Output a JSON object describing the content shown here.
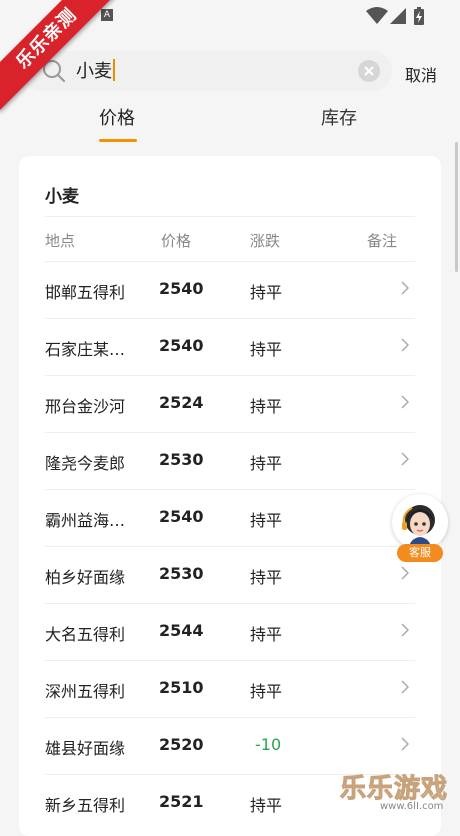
{
  "status_bar": {
    "a_icon": "A",
    "icons": [
      "wifi-icon",
      "cell-signal-icon",
      "battery-charging-icon"
    ]
  },
  "ribbon": {
    "text": "乐乐亲测"
  },
  "search": {
    "query": "小麦",
    "cancel_label": "取消"
  },
  "tabs": [
    {
      "label": "价格",
      "active": true
    },
    {
      "label": "库存",
      "active": false
    }
  ],
  "card": {
    "title": "小麦",
    "columns": [
      "地点",
      "价格",
      "涨跌",
      "备注"
    ],
    "rows": [
      {
        "location": "邯郸五得利",
        "price": "2540",
        "change": "持平"
      },
      {
        "location": "石家庄某…",
        "price": "2540",
        "change": "持平"
      },
      {
        "location": "邢台金沙河",
        "price": "2524",
        "change": "持平"
      },
      {
        "location": "隆尧今麦郎",
        "price": "2530",
        "change": "持平"
      },
      {
        "location": "霸州益海…",
        "price": "2540",
        "change": "持平"
      },
      {
        "location": "柏乡好面缘",
        "price": "2530",
        "change": "持平"
      },
      {
        "location": "大名五得利",
        "price": "2544",
        "change": "持平"
      },
      {
        "location": "深州五得利",
        "price": "2510",
        "change": "持平"
      },
      {
        "location": "雄县好面缘",
        "price": "2520",
        "change": "-10"
      },
      {
        "location": "新乡五得利",
        "price": "2521",
        "change": "持平"
      }
    ]
  },
  "service": {
    "label": "客服"
  },
  "watermark": {
    "title": "乐乐游戏",
    "url": "www.6lI.com"
  },
  "colors": {
    "accent": "#f39200",
    "ribbon": "#d9232a",
    "down": "#2aa54a"
  }
}
